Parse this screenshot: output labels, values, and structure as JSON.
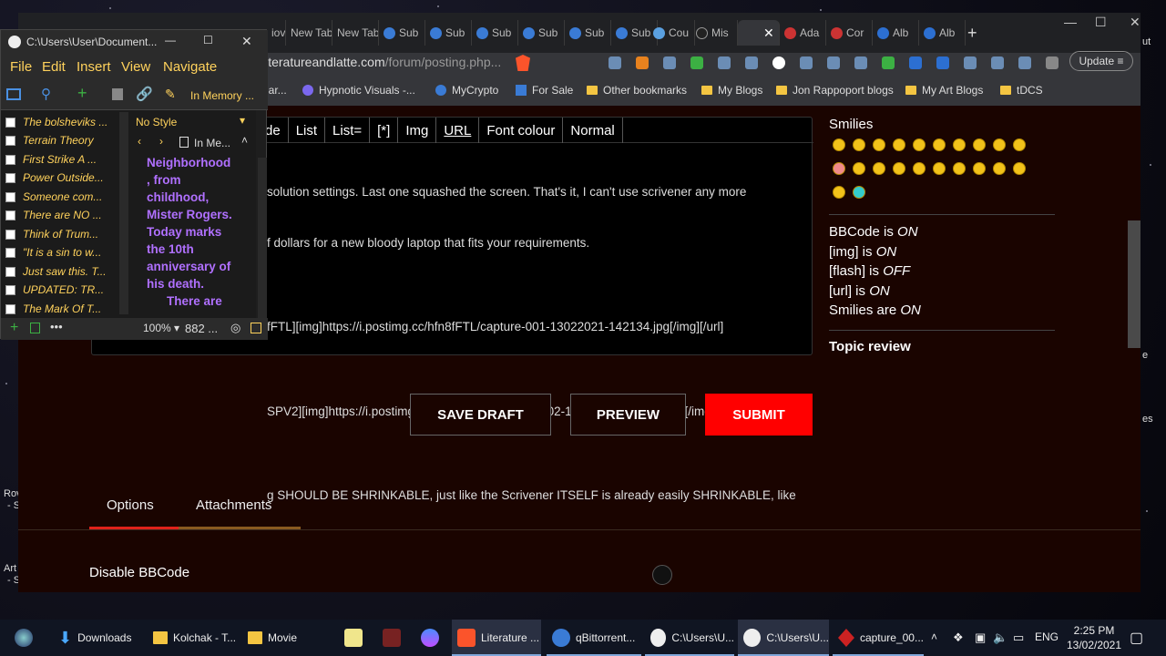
{
  "browser": {
    "tabs": [
      "New Tab",
      "New Tab",
      "Sub",
      "Sub",
      "Sub",
      "Sub",
      "Sub",
      "Sub",
      "Cou",
      "Mis",
      "",
      "Ada",
      "Cor",
      "Alb",
      "Alb"
    ],
    "url_host": "literatureandlatte.com",
    "url_path": "/forum/posting.php...",
    "update_label": "Update",
    "bookmarks": [
      "Hypnotic Visuals -...",
      "MyCrypto",
      "For Sale",
      "Other bookmarks",
      "My Blogs",
      "Jon Rappoport blogs",
      "My Art Blogs",
      "tDCS"
    ]
  },
  "editor": {
    "toolbar": [
      "de",
      "List",
      "List=",
      "[*]",
      "Img",
      "URL",
      "Font colour",
      "Normal"
    ],
    "lines": [
      "solution settings. Last one squashed the screen. That's it, I can't use scrivener any more",
      "f dollars for a new bloody laptop that fits your requirements.",
      "",
      "fFTL][img]https://i.postimg.cc/hfn8fFTL/capture-001-13022021-142134.jpg[/img][/url]",
      "",
      "SPV2][img]https://i.postimg.cc/F7xySPV2/capture-002-13022021-142137.jpg[/img][/url]",
      "",
      "g SHOULD BE SHRINKABLE, just like the Scrivener ITSELF is already easily SHRINKABLE, like"
    ]
  },
  "side": {
    "smilies_title": "Smilies",
    "bbcode": "BBCode is ",
    "bbcode_state": "ON",
    "img": "[img] is ",
    "img_state": "ON",
    "flash": "[flash] is ",
    "flash_state": "OFF",
    "url": "[url] is ",
    "url_state": "ON",
    "smilies": "Smilies are ",
    "smilies_state": "ON",
    "topic_review": "Topic review"
  },
  "buttons": {
    "save_draft": "SAVE DRAFT",
    "preview": "PREVIEW",
    "submit": "SUBMIT"
  },
  "options_tabs": {
    "options": "Options",
    "attachments": "Attachments"
  },
  "disable_bbcode": "Disable BBCode",
  "scrivener": {
    "title": "C:\\Users\\User\\Document...",
    "menu": [
      "File",
      "Edit",
      "Insert",
      "View",
      "Navigate"
    ],
    "collection": "In Memory ...",
    "style": "No Style",
    "doc_title": "In Me...",
    "binder": [
      "The bolsheviks ...",
      "Terrain Theory",
      "First Strike A ...",
      "Power Outside...",
      "Someone com...",
      "There are NO ...",
      "Think of Trum...",
      "\"It is a sin to w...",
      "Just saw this. T...",
      "UPDATED: TR...",
      "The Mark Of T..."
    ],
    "doc_lines": [
      "Neighborhood",
      ", from",
      "childhood,",
      "Mister Rogers.",
      "Today marks",
      "the 10th",
      "anniversary of",
      "his death.",
      "There are"
    ],
    "zoom": "100%",
    "word_count": "882 ..."
  },
  "taskbar": {
    "items": [
      "Downloads",
      "Kolchak - T...",
      "Movie",
      "",
      "",
      "",
      "Literature ...",
      "qBittorrent...",
      "C:\\Users\\U...",
      "C:\\Users\\U...",
      "capture_00..."
    ],
    "lang": "ENG",
    "time": "2:25 PM",
    "date": "13/02/2021"
  },
  "desktop_fragments": [
    "ut",
    "Rov",
    "- S",
    "Art",
    "- S",
    "es",
    "e"
  ]
}
